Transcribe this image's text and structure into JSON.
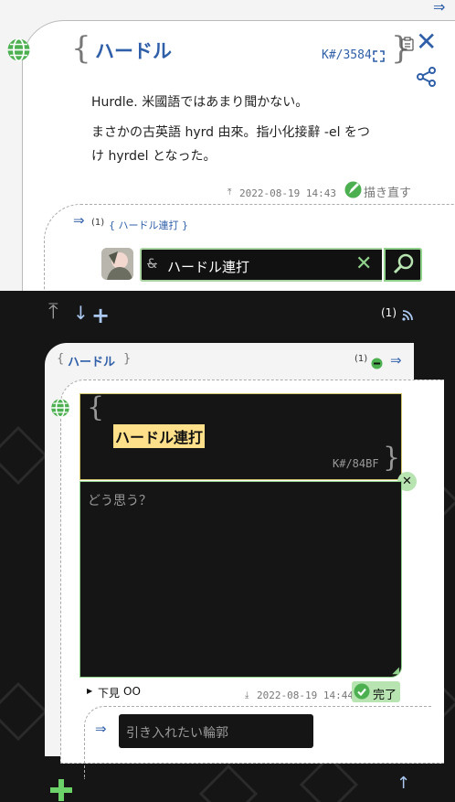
{
  "header": {
    "arrow_label": "⇒",
    "close_glyph": "✕"
  },
  "post": {
    "open_brace": "{",
    "close_brace": "}",
    "title": "ハードル",
    "id": "K#/3584",
    "body": [
      "Hurdle. 米國語ではあまり聞かない。",
      "まさかの古英語 hyrd 由來。指小化接辭 -el をつ",
      "け hyrdel となった。"
    ],
    "timestamp": "2022-08-19 14:43",
    "redraw_label": "描き直す"
  },
  "thread": {
    "count": "(1)",
    "link": "{ ハードル連打 }",
    "input_value": "ハードル連打"
  },
  "dark_bar": {
    "count": "(1)"
  },
  "panel": {
    "crumb_open": "{",
    "crumb_title": "ハードル",
    "crumb_close": "}",
    "count": "(1)",
    "quote_title": "ハードル連打",
    "quote_id": "K#/84BF",
    "reply_placeholder": "どう思う？",
    "preview_label": "下見",
    "timestamp": "2022-08-19 14:44",
    "done_label": "完了",
    "cite_placeholder": "引き入れたい輪郭"
  },
  "colors": {
    "accent": "#2f5fa8",
    "green": "#4caf50",
    "highlight": "#ffe08a"
  }
}
